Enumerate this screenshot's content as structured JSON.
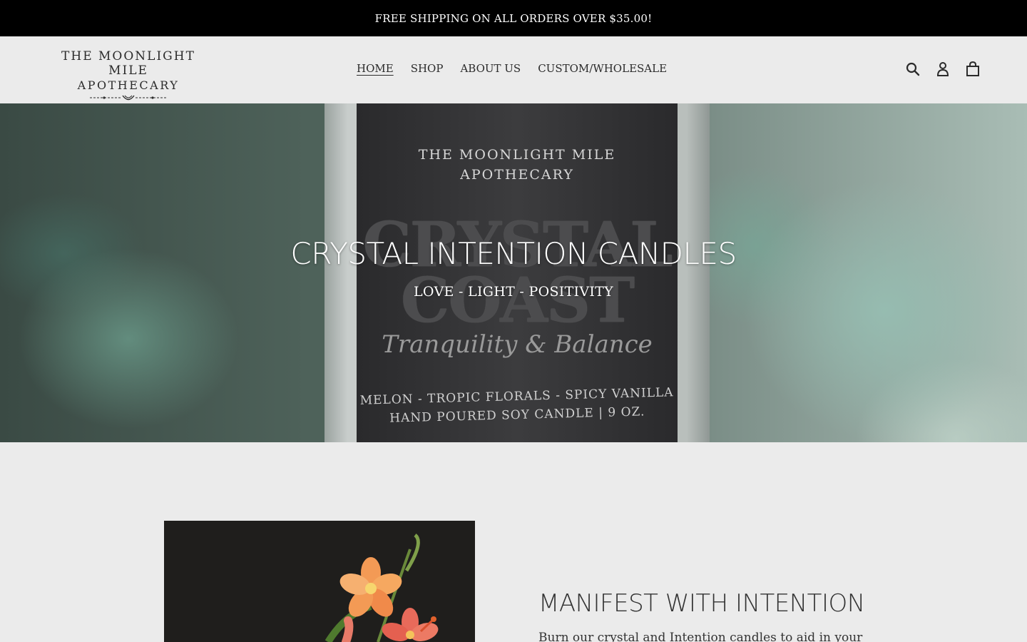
{
  "announcement": {
    "text": "FREE SHIPPING ON ALL ORDERS OVER $35.00!"
  },
  "header": {
    "logo": {
      "line1": "THE MOONLIGHT MILE",
      "line2": "APOTHECARY"
    },
    "nav": [
      {
        "label": "HOME",
        "active": true
      },
      {
        "label": "SHOP"
      },
      {
        "label": "ABOUT US"
      },
      {
        "label": "CUSTOM/WHOLESALE"
      }
    ],
    "icons": [
      "search-icon",
      "account-icon",
      "cart-icon"
    ]
  },
  "hero": {
    "title": "CRYSTAL INTENTION CANDLES",
    "subtitle": "LOVE - LIGHT - POSITIVITY",
    "product_label": {
      "brand_line1": "THE MOONLIGHT MILE",
      "brand_line2": "APOTHECARY",
      "name_line1": "CRYSTAL",
      "name_line2": "COAST",
      "tagline": "Tranquility & Balance",
      "notes": "MELON - TROPIC FLORALS - SPICY VANILLA",
      "details": "HAND POURED SOY CANDLE | 9 OZ."
    }
  },
  "feature": {
    "title": "MANIFEST WITH INTENTION",
    "text": "Burn our crystal and Intention candles to aid in your"
  },
  "colors": {
    "announcement_bg": "#000000",
    "page_bg": "#ebebeb",
    "text": "#2b2b2b"
  }
}
